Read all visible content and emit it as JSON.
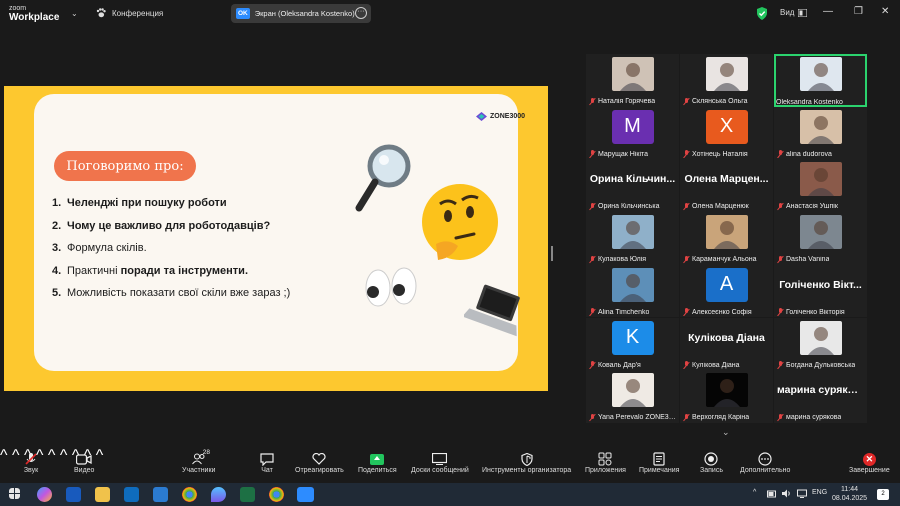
{
  "app": {
    "brand_line1": "zoom",
    "brand_line2": "Workplace"
  },
  "topbar": {
    "conference_label": "Конференция",
    "screen_badge": "OK",
    "screen_label": "Экран (Oleksandra Kostenko)",
    "view_label": "Вид"
  },
  "slide": {
    "brand": "ZONE3000",
    "heading": "Поговоримо про:",
    "items": [
      {
        "num": "1.",
        "bold": "Челенджі при пошуку роботи",
        "rest": ""
      },
      {
        "num": "2.",
        "bold": "Чому це важливо для роботодавців?",
        "rest": ""
      },
      {
        "num": "3.",
        "bold": "",
        "rest": "Формула скілів."
      },
      {
        "num": "4.",
        "bold": "поради та інструменти.",
        "prefix": "Практичні "
      },
      {
        "num": "5.",
        "bold": "",
        "rest": "Можливість показати свої скіли вже зараз ;)"
      }
    ]
  },
  "participants": [
    {
      "name": "Наталія Горячева",
      "type": "photo",
      "color": "#cfc2b6",
      "muted": true
    },
    {
      "name": "Склянська Ольга",
      "type": "photo",
      "color": "#e9e4e2",
      "muted": true
    },
    {
      "name": "Oleksandra Kostenko",
      "type": "photo",
      "color": "#dfe7ef",
      "muted": false,
      "active": true
    },
    {
      "name": "Марущак Нікіта",
      "type": "avatar",
      "letter": "M",
      "color": "#6a2fb0",
      "muted": true
    },
    {
      "name": "Хотінець Наталія",
      "type": "avatar",
      "letter": "X",
      "color": "#e85a1e",
      "muted": true
    },
    {
      "name": "alina dudorova",
      "type": "photo",
      "color": "#d7c0a8",
      "muted": true
    },
    {
      "name": "Орина Кільчинська",
      "type": "text",
      "big": "Орина Кільчин...",
      "muted": true
    },
    {
      "name": "Олена Марценюк",
      "type": "text",
      "big": "Олена Марцен...",
      "muted": true
    },
    {
      "name": "Анастасія Ушпік",
      "type": "photo",
      "color": "#8a5a4a",
      "muted": true
    },
    {
      "name": "Кулакова Юлія",
      "type": "photo",
      "color": "#8fb0c9",
      "muted": true
    },
    {
      "name": "Караманчук Альона",
      "type": "photo",
      "color": "#c9a47a",
      "muted": true
    },
    {
      "name": "Dasha Vanina",
      "type": "photo",
      "color": "#7d8790",
      "muted": true
    },
    {
      "name": "Alina Timchenko",
      "type": "photo",
      "color": "#5d8fb8",
      "muted": true
    },
    {
      "name": "Алексеєнко Софія",
      "type": "avatar",
      "letter": "A",
      "color": "#1a6fc9",
      "muted": true
    },
    {
      "name": "Голіченко Вікторія",
      "type": "text",
      "big": "Голіченко Вікт...",
      "muted": true
    },
    {
      "name": "Коваль Дар'я",
      "type": "avatar",
      "letter": "K",
      "color": "#1c8ce8",
      "muted": true
    },
    {
      "name": "Кулікова Діана",
      "type": "text",
      "big": "Кулікова Діана",
      "muted": true
    },
    {
      "name": "Богдана Дульковська",
      "type": "photo",
      "color": "#e8e8e8",
      "muted": true
    },
    {
      "name": "Yana Perevalo ZONE30...",
      "type": "photo",
      "color": "#efeae4",
      "muted": true
    },
    {
      "name": "Верхогляд Каріна",
      "type": "photo",
      "color": "#050505",
      "muted": true
    },
    {
      "name": "марина сурякова",
      "type": "text",
      "big": "марина сурякова",
      "muted": true
    }
  ],
  "toolbar": {
    "audio": "Звук",
    "video": "Видео",
    "participants": "Участники",
    "participants_count": "28",
    "chat": "Чат",
    "react": "Отреагировать",
    "share": "Поделиться",
    "whiteboards": "Доски сообщений",
    "host_tools": "Инструменты организатора",
    "apps": "Приложения",
    "notes": "Примечания",
    "record": "Запись",
    "more": "Дополнительно",
    "end": "Завершение"
  },
  "taskbar": {
    "lang": "ENG",
    "time": "11:44",
    "date": "08.04.2025",
    "notifications": "2"
  }
}
